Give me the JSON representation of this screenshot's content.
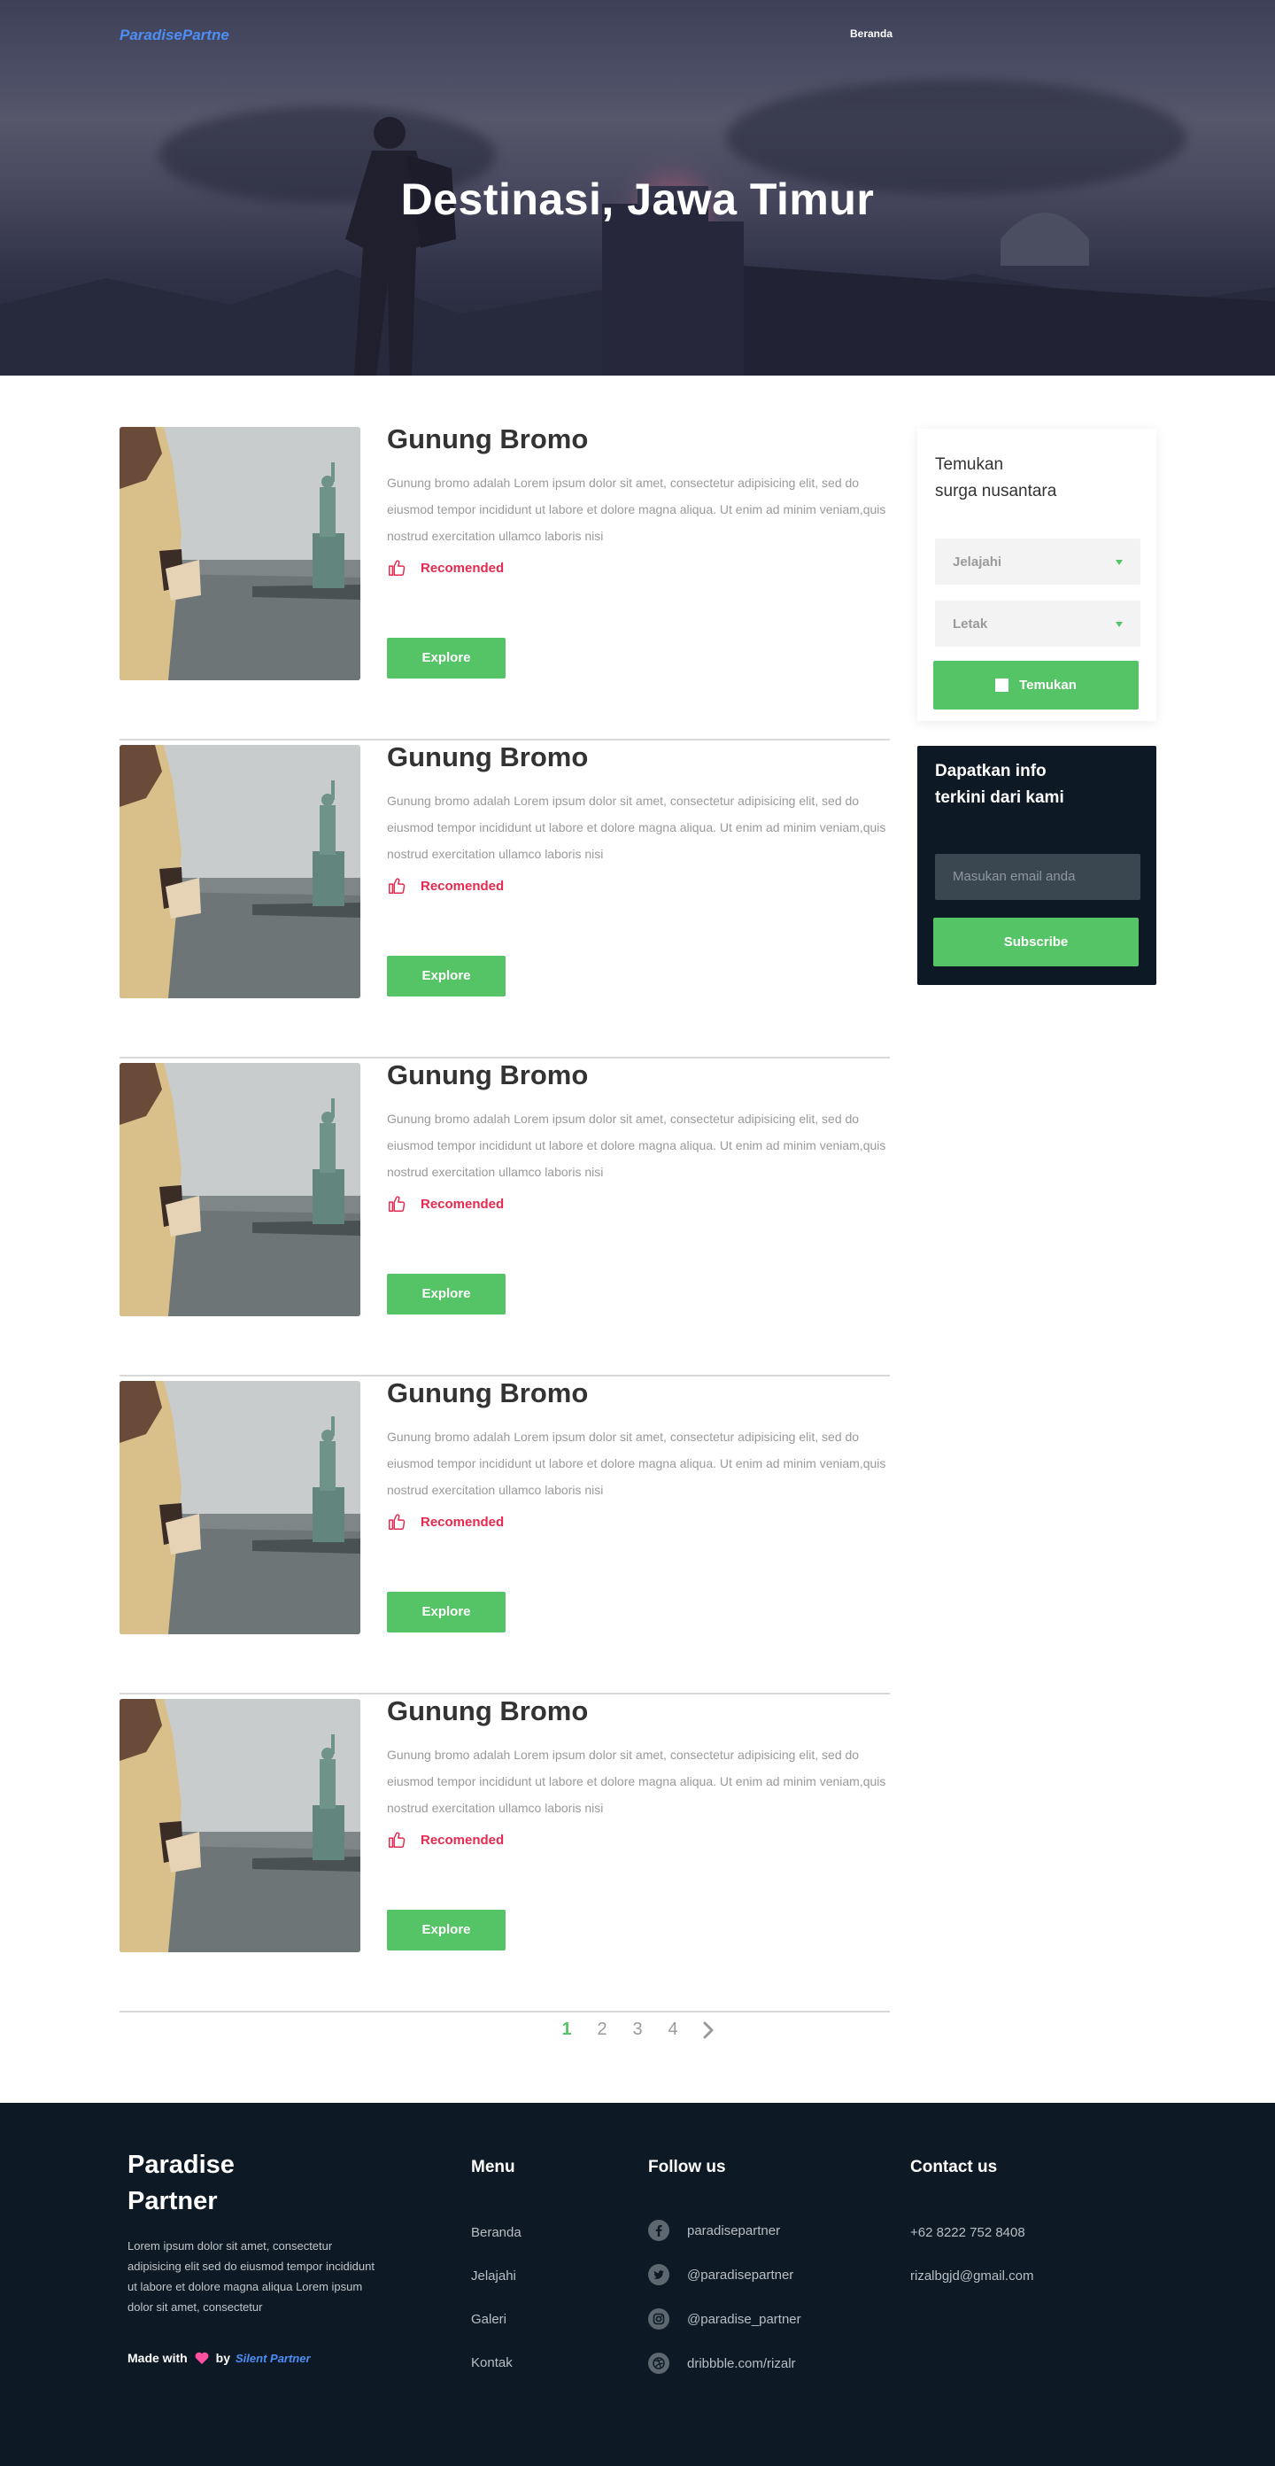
{
  "header": {
    "logo": "ParadisePartne",
    "nav": [
      "Beranda"
    ],
    "hero_title": "Destinasi, Jawa Timur"
  },
  "destinations": [
    {
      "title": "Gunung Bromo",
      "description": "Gunung bromo adalah Lorem ipsum dolor sit amet, consectetur adipisicing elit, sed do eiusmod tempor incididunt ut labore et dolore magna aliqua. Ut enim ad minim veniam,quis nostrud exercitation ullamco laboris nisi",
      "badge": "Recomended",
      "button": "Explore"
    },
    {
      "title": "Gunung Bromo",
      "description": "Gunung bromo adalah Lorem ipsum dolor sit amet, consectetur adipisicing elit, sed do eiusmod tempor incididunt ut labore et dolore magna aliqua. Ut enim ad minim veniam,quis nostrud exercitation ullamco laboris nisi",
      "badge": "Recomended",
      "button": "Explore"
    },
    {
      "title": "Gunung Bromo",
      "description": "Gunung bromo adalah Lorem ipsum dolor sit amet, consectetur adipisicing elit, sed do eiusmod tempor incididunt ut labore et dolore magna aliqua. Ut enim ad minim veniam,quis nostrud exercitation ullamco laboris nisi",
      "badge": "Recomended",
      "button": "Explore"
    },
    {
      "title": "Gunung Bromo",
      "description": "Gunung bromo adalah Lorem ipsum dolor sit amet, consectetur adipisicing elit, sed do eiusmod tempor incididunt ut labore et dolore magna aliqua. Ut enim ad minim veniam,quis nostrud exercitation ullamco laboris nisi",
      "badge": "Recomended",
      "button": "Explore"
    },
    {
      "title": "Gunung Bromo",
      "description": "Gunung bromo adalah Lorem ipsum dolor sit amet, consectetur adipisicing elit, sed do eiusmod tempor incididunt ut labore et dolore magna aliqua. Ut enim ad minim veniam,quis nostrud exercitation ullamco laboris nisi",
      "badge": "Recomended",
      "button": "Explore"
    }
  ],
  "search": {
    "heading_line1": "Temukan",
    "heading_line2": "surga nusantara",
    "select_1": "Jelajahi",
    "select_2": "Letak",
    "button": "Temukan"
  },
  "subscribe": {
    "heading_line1": "Dapatkan info",
    "heading_line2": "terkini dari kami",
    "placeholder": "Masukan email anda",
    "button": "Subscribe"
  },
  "pagination": {
    "pages": [
      "1",
      "2",
      "3",
      "4"
    ],
    "current": "1"
  },
  "footer": {
    "brand_line1": "Paradise",
    "brand_line2": "Partner",
    "about": "Lorem ipsum dolor sit amet, consectetur adipisicing elit sed do eiusmod tempor incididunt ut labore et dolore magna aliqua Lorem ipsum dolor sit amet, consectetur",
    "made_with": "Made with",
    "by": "by",
    "by_name": "Silent Partner",
    "menu_title": "Menu",
    "menu": [
      "Beranda",
      "Jelajahi",
      "Galeri",
      "Kontak"
    ],
    "follow_title": "Follow us",
    "social": [
      {
        "icon": "facebook-icon",
        "label": "paradisepartner"
      },
      {
        "icon": "twitter-icon",
        "label": "@paradisepartner"
      },
      {
        "icon": "instagram-icon",
        "label": "@paradise_partner"
      },
      {
        "icon": "dribbble-icon",
        "label": "dribbble.com/rizalr"
      }
    ],
    "contact_title": "Contact us",
    "contact": [
      "+62 8222 752 8408",
      "rizalbgjd@gmail.com"
    ]
  },
  "colors": {
    "accent_green": "#55c466",
    "badge_red": "#e8294f",
    "logo_blue": "#4d8ef5",
    "footer_bg": "#0d1a26"
  }
}
